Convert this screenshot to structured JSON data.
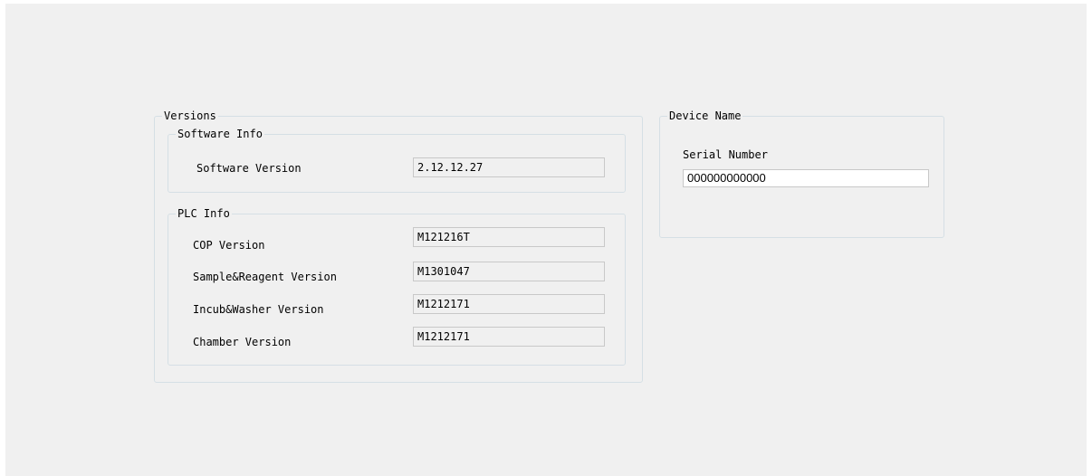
{
  "versions": {
    "title": "Versions",
    "software_info": {
      "title": "Software Info",
      "software_version_label": "Software Version",
      "software_version_value": "2.12.12.27"
    },
    "plc_info": {
      "title": "PLC Info",
      "rows": [
        {
          "label": "COP Version",
          "value": "M121216T"
        },
        {
          "label": "Sample&Reagent Version",
          "value": "M1301047"
        },
        {
          "label": "Incub&Washer Version",
          "value": "M1212171"
        },
        {
          "label": "Chamber Version",
          "value": "M1212171"
        }
      ]
    }
  },
  "device": {
    "title": "Device Name",
    "serial_label": "Serial Number",
    "serial_value": "000000000000"
  }
}
